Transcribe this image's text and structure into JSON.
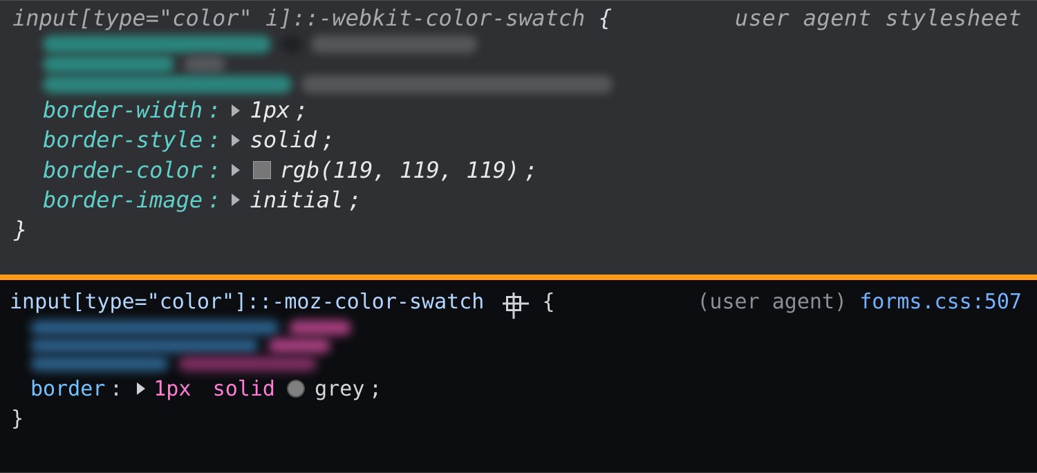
{
  "webkit": {
    "selector": "input[type=\"color\" i]::-webkit-color-swatch",
    "brace_open": "{",
    "brace_close": "}",
    "source_label": "user agent stylesheet",
    "decls": {
      "border_width": {
        "prop": "border-width",
        "value": "1px"
      },
      "border_style": {
        "prop": "border-style",
        "value": "solid"
      },
      "border_color": {
        "prop": "border-color",
        "value": "rgb(119, 119, 119)",
        "swatch": "#777777"
      },
      "border_image": {
        "prop": "border-image",
        "value": "initial"
      }
    }
  },
  "moz": {
    "selector": "input[type=\"color\"]::-moz-color-swatch",
    "brace_open": "{",
    "brace_close": "}",
    "source_ua": "(user agent)",
    "source_file": "forms.css:507",
    "decls": {
      "border": {
        "prop": "border",
        "size": "1px",
        "style": "solid",
        "color_name": "grey",
        "swatch": "#808080"
      }
    }
  },
  "punct": {
    "semicolon": ";",
    "colon": ":"
  }
}
